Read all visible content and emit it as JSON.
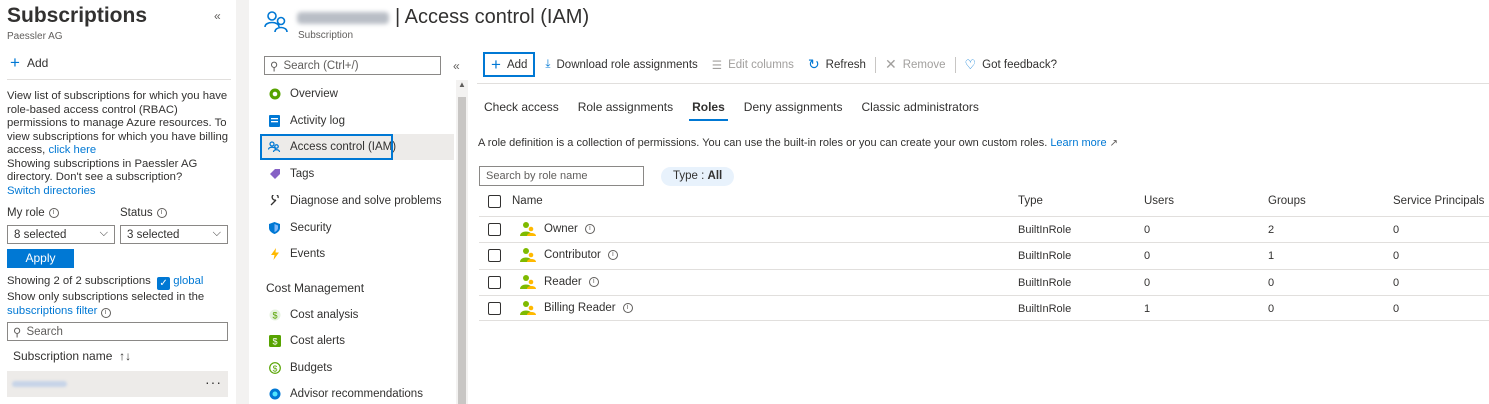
{
  "left_blade": {
    "title": "Subscriptions",
    "subtitle": "Paessler AG",
    "add_label": "Add",
    "description_line1": "View list of subscriptions for which you have role-based access control (RBAC) permissions to manage Azure resources. To view subscriptions for which you have billing access,",
    "click_here": "click here",
    "directory_text": "Showing subscriptions in Paessler AG directory. Don't see a subscription?",
    "switch_directories": "Switch directories",
    "my_role_label": "My role",
    "status_label": "Status",
    "my_role_value": "8 selected",
    "status_value": "3 selected",
    "apply_label": "Apply",
    "showing_text": "Showing 2 of 2 subscriptions",
    "global_label": "global",
    "show_only_text": "Show only subscriptions selected in the",
    "subscriptions_filter": "subscriptions filter",
    "search_placeholder": "Search",
    "column_subscription_name": "Subscription name",
    "row_more": "···"
  },
  "header": {
    "title": "| Access control (IAM)",
    "subtitle": "Subscription"
  },
  "menu": {
    "search_placeholder": "Search (Ctrl+/)",
    "items": [
      {
        "label": "Overview",
        "icon": "overview-icon"
      },
      {
        "label": "Activity log",
        "icon": "activity-log-icon"
      },
      {
        "label": "Access control (IAM)",
        "icon": "iam-icon"
      },
      {
        "label": "Tags",
        "icon": "tag-icon"
      },
      {
        "label": "Diagnose and solve problems",
        "icon": "wrench-icon"
      },
      {
        "label": "Security",
        "icon": "shield-icon"
      },
      {
        "label": "Events",
        "icon": "lightning-icon"
      }
    ],
    "cost_section": "Cost Management",
    "cost_items": [
      {
        "label": "Cost analysis",
        "icon": "cost-analysis-icon"
      },
      {
        "label": "Cost alerts",
        "icon": "cost-alerts-icon"
      },
      {
        "label": "Budgets",
        "icon": "budgets-icon"
      },
      {
        "label": "Advisor recommendations",
        "icon": "advisor-icon"
      }
    ]
  },
  "toolbar": {
    "add": "Add",
    "download": "Download role assignments",
    "edit_columns": "Edit columns",
    "refresh": "Refresh",
    "remove": "Remove",
    "feedback": "Got feedback?"
  },
  "tabs": [
    "Check access",
    "Role assignments",
    "Roles",
    "Deny assignments",
    "Classic administrators"
  ],
  "active_tab": "Roles",
  "role_description": "A role definition is a collection of permissions. You can use the built-in roles or you can create your own custom roles.",
  "learn_more": "Learn more",
  "role_search_placeholder": "Search by role name",
  "type_filter_prefix": "Type : ",
  "type_filter_value": "All",
  "table": {
    "columns": [
      "Name",
      "Type",
      "Users",
      "Groups",
      "Service Principals"
    ],
    "rows": [
      {
        "name": "Owner",
        "type": "BuiltInRole",
        "users": "0",
        "groups": "2",
        "sp": "0"
      },
      {
        "name": "Contributor",
        "type": "BuiltInRole",
        "users": "0",
        "groups": "1",
        "sp": "0"
      },
      {
        "name": "Reader",
        "type": "BuiltInRole",
        "users": "0",
        "groups": "0",
        "sp": "0"
      },
      {
        "name": "Billing Reader",
        "type": "BuiltInRole",
        "users": "1",
        "groups": "0",
        "sp": "0"
      }
    ]
  },
  "colors": {
    "accent": "#0078d4",
    "selected_bg": "#edebe9",
    "text": "#323130"
  }
}
